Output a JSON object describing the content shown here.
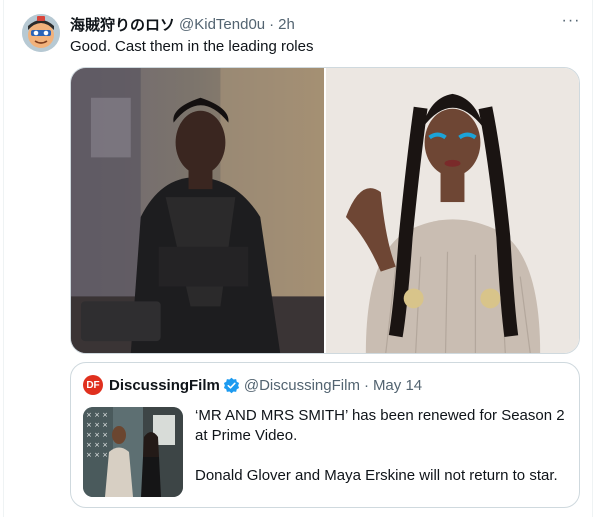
{
  "tweet": {
    "author_name": "海賊狩りのロソ",
    "author_handle": "@KidTend0u",
    "separator": "·",
    "time": "2h",
    "more_label": "···",
    "text": "Good. Cast them in the leading roles",
    "avatar_icon": "cartoon-face-icon"
  },
  "quoted_tweet": {
    "logo_text": "DF",
    "account_name": "DiscussingFilm",
    "handle": "@DiscussingFilm",
    "separator": "·",
    "date": "May 14",
    "verified_icon": "verified-badge-icon",
    "text_line_1": "‘MR AND MRS SMITH’ has been renewed for Season 2 at Prime Video.",
    "text_line_2": "Donald Glover and Maya Erskine will not return to star."
  },
  "colors": {
    "text_primary": "#0f1419",
    "text_secondary": "#536471",
    "border": "#cfd9de",
    "verified_blue": "#1d9bf0",
    "brand_red": "#e0301e"
  }
}
